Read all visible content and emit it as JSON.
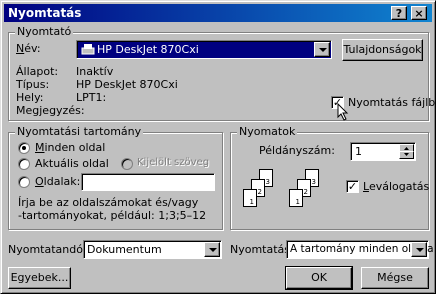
{
  "title": "Nyomtatás",
  "title_buttons": {
    "help": "?",
    "close": "×"
  },
  "printer": {
    "group_label": "Nyomtató",
    "name_label": "Név:",
    "name_value": "HP DeskJet 870Cxi",
    "properties_button": "Tulajdonságok",
    "status_label": "Állapot:",
    "status_value": "Inaktív",
    "type_label": "Típus:",
    "type_value": "HP DeskJet 870Cxi",
    "where_label": "Hely:",
    "where_value": "LPT1:",
    "comment_label": "Megjegyzés:",
    "print_to_file_label": "Nyomtatás fájlba",
    "print_to_file_checked": true
  },
  "range": {
    "group_label": "Nyomtatási tartomány",
    "all_label": "Minden oldal",
    "current_label": "Aktuális oldal",
    "selection_label": "Kijelölt szöveg",
    "pages_label": "Oldalak:",
    "pages_value": "",
    "hint": "Írja be az oldalszámokat és/vagy\n-tartományokat, például: 1;3;5–12",
    "selected": "all"
  },
  "copies": {
    "group_label": "Nyomatok",
    "count_label": "Példányszám:",
    "count_value": "1",
    "collate_label": "Leválogatás",
    "collate_checked": true,
    "stack1_pages": [
      "3",
      "2",
      "1"
    ],
    "stack2_pages": [
      "3",
      "2",
      "1"
    ]
  },
  "print_what": {
    "label": "Nyomtatandó:",
    "value": "Dokumentum"
  },
  "print": {
    "label": "Nyomtatás:",
    "value": "A tartomány minden oldala"
  },
  "buttons": {
    "options": "Egyebek...",
    "ok": "OK",
    "cancel": "Mégse"
  }
}
